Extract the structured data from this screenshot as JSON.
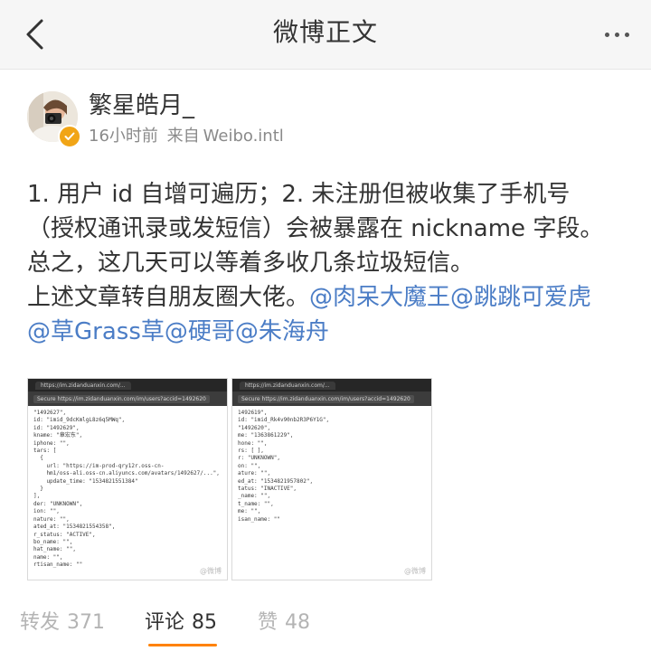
{
  "header": {
    "title": "微博正文"
  },
  "author": {
    "name": "繁星皓月_",
    "time": "16小时前",
    "source_prefix": "来自",
    "source": "Weibo.intl"
  },
  "post": {
    "line1": "1. 用户 id 自增可遍历；2. 未注册但被收集了手机号",
    "line2": "（授权通讯录或发短信）会被暴露在 nickname 字段。",
    "line3": "总之，这几天可以等着多收几条垃圾短信。",
    "line4_text": "上述文章转自朋友圈大佬。",
    "mentions": [
      "@肉呆大魔王",
      "@跳跳可爱虎",
      "@草Grass草",
      "@硬哥",
      "@朱海舟"
    ]
  },
  "images": [
    {
      "tab": "https://im.zidanduanxin.com/...",
      "url": "Secure  https://im.zidanduanxin.com/im/users?accid=1492620",
      "code": [
        "\"1492627\",",
        "id: \"imid_9dcKmlgL8z6q5MWq\",",
        "id: \"1492629\",",
        "kname: \"章宏东\",",
        "iphone: \"\",",
        "tars: [",
        "  {",
        "    url: \"https://im-prod-qry12r.oss-cn-",
        "    hm1/oss-ali.oss-cn.aliyuncs.com/avatars/1492627/...\",",
        "    update_time: \"1534821551384\"",
        "  }",
        "],",
        "der: \"UNKNOWN\",",
        "ion: \"\",",
        "nature: \"\",",
        "ated_at: \"1534821554358\",",
        "r_status: \"ACTIVE\",",
        "bo_name: \"\",",
        "hat_name: \"\",",
        "name: \"\",",
        "rtisan_name: \"\""
      ],
      "watermark": "@微博"
    },
    {
      "tab": "https://im.zidanduanxin.com/...",
      "url": "Secure  https://im.zidanduanxin.com/im/users?accid=1492620",
      "code": [
        "1492619\",",
        "id: \"imid_Rk4v90nb2R3P6Y1G\",",
        "\"1492620\",",
        "me: \"1363861229\",",
        "hone: \"\",",
        "rs: [ ],",
        "r: \"UNKNOWN\",",
        "on: \"\",",
        "ature: \"\",",
        "ed_at: \"1534821957802\",",
        "tatus: \"INACTIVE\",",
        "_name: \"\",",
        "t_name: \"\",",
        "me: \"\",",
        "isan_name: \"\""
      ],
      "watermark": "@微博"
    }
  ],
  "stats": {
    "reposts_label": "转发",
    "reposts_count": "371",
    "comments_label": "评论",
    "comments_count": "85",
    "likes_label": "赞",
    "likes_count": "48"
  },
  "colors": {
    "mention": "#4b7dc6",
    "accent": "#ff8200",
    "verified": "#f1a516"
  },
  "icons": {
    "back": "chevron-left-icon",
    "more": "more-dots-icon",
    "verified": "verified-check-icon"
  }
}
